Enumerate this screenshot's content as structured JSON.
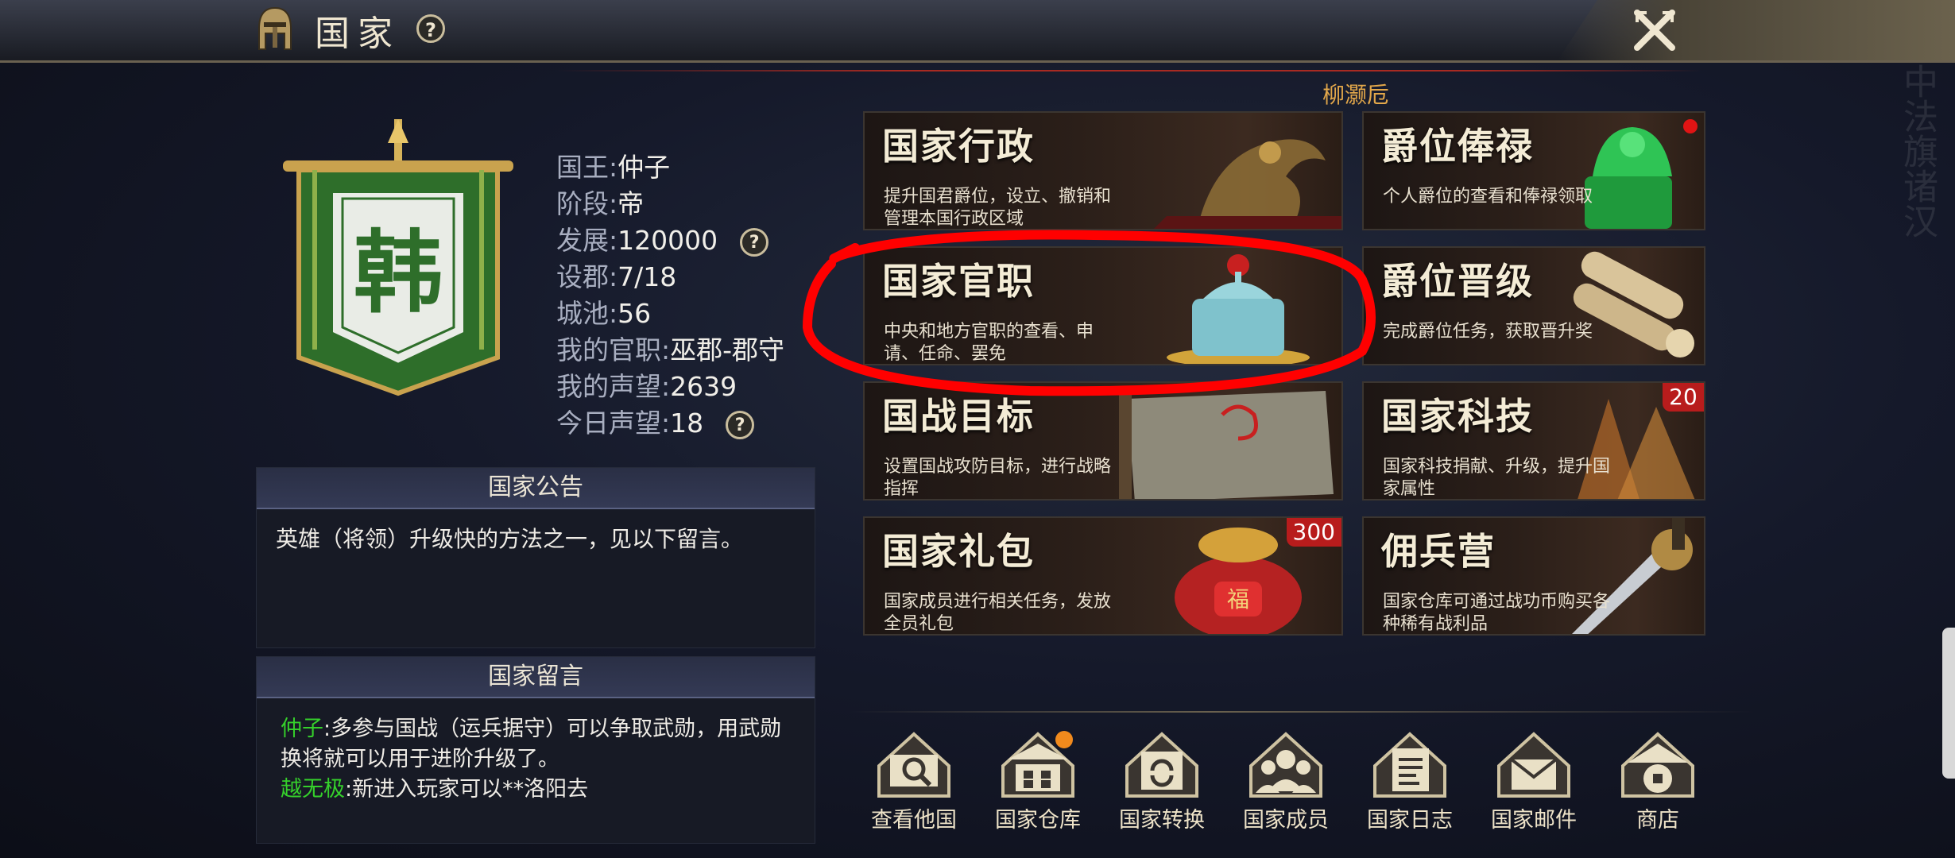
{
  "header": {
    "title": "国家",
    "help_icon": "question-circle-icon",
    "close_icon": "crossed-swords-icon"
  },
  "server_label": "柳灏卮",
  "kingdom": {
    "banner_char": "韩",
    "stats": [
      {
        "label": "国王:",
        "value": "仲子"
      },
      {
        "label": "阶段:",
        "value": "帝"
      },
      {
        "label": "发展:",
        "value": "120000",
        "help": true
      },
      {
        "label": "设郡:",
        "value": "7/18"
      },
      {
        "label": "城池:",
        "value": "56"
      },
      {
        "label": "我的官职:",
        "value": "巫郡-郡守"
      },
      {
        "label": "我的声望:",
        "value": "2639"
      },
      {
        "label": "今日声望:",
        "value": "18",
        "help": true
      }
    ]
  },
  "notice": {
    "title": "国家公告",
    "text": "英雄（将领）升级快的方法之一，见以下留言。"
  },
  "messages": {
    "title": "国家留言",
    "items": [
      {
        "name": "仲子",
        "text": ":多参与国战（运兵据守）可以争取武勋，用武勋换将就可以用于进阶升级了。"
      },
      {
        "name": "越无极",
        "text": ":新进入玩家可以**洛阳去"
      }
    ]
  },
  "cards": [
    {
      "title": "国家行政",
      "desc": "提升国君爵位，设立、撤销和管理本国行政区域",
      "badge": ""
    },
    {
      "title": "爵位俸禄",
      "desc": "个人爵位的查看和俸禄领取",
      "badge": "",
      "dot": true
    },
    {
      "title": "国家官职",
      "desc": "中央和地方官职的查看、申请、任命、罢免",
      "badge": ""
    },
    {
      "title": "爵位晋级",
      "desc": "完成爵位任务，获取晋升奖",
      "badge": ""
    },
    {
      "title": "国战目标",
      "desc": "设置国战攻防目标，进行战略指挥",
      "badge": ""
    },
    {
      "title": "国家科技",
      "desc": "国家科技捐献、升级，提升国家属性",
      "badge": "20"
    },
    {
      "title": "国家礼包",
      "desc": "国家成员进行相关任务，发放全员礼包",
      "badge": "300"
    },
    {
      "title": "佣兵营",
      "desc": "国家仓库可通过战功币购买各种稀有战利品",
      "badge": ""
    }
  ],
  "bottom_buttons": [
    {
      "label": "查看他国",
      "icon": "magnifier-scroll-icon"
    },
    {
      "label": "国家仓库",
      "icon": "warehouse-icon",
      "dot": true
    },
    {
      "label": "国家转换",
      "icon": "transfer-icon"
    },
    {
      "label": "国家成员",
      "icon": "members-icon"
    },
    {
      "label": "国家日志",
      "icon": "log-book-icon"
    },
    {
      "label": "国家邮件",
      "icon": "mail-icon"
    },
    {
      "label": "商店",
      "icon": "coin-shop-icon"
    }
  ],
  "colors": {
    "accent_gold": "#e2a74a",
    "name_green": "#35d02b",
    "badge_red": "#b81c1c",
    "annotation_red": "#ff0000"
  }
}
